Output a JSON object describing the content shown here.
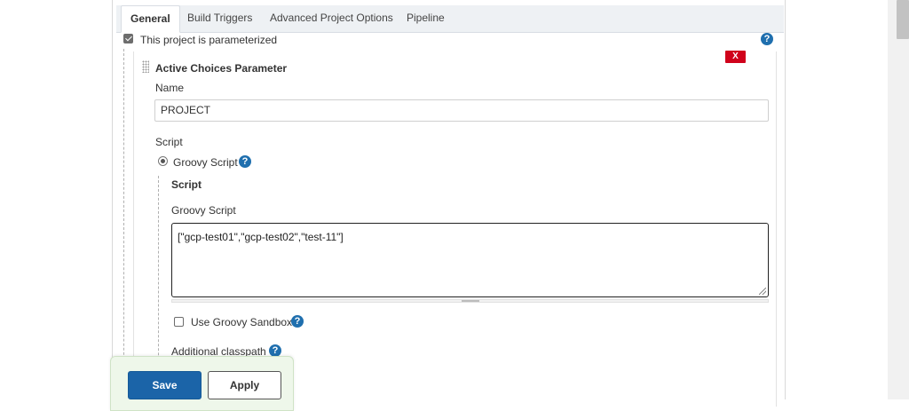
{
  "tabs": [
    {
      "label": "General",
      "active": true
    },
    {
      "label": "Build Triggers",
      "active": false
    },
    {
      "label": "Advanced Project Options",
      "active": false
    },
    {
      "label": "Pipeline",
      "active": false
    }
  ],
  "parameterized": {
    "label": "This project is parameterized",
    "checked": true
  },
  "parameter": {
    "title": "Active Choices Parameter",
    "remove_label": "X",
    "name_label": "Name",
    "name_value": "PROJECT",
    "script_label": "Script",
    "groovy_radio_label": "Groovy Script",
    "script_section_title": "Script",
    "groovy_script_label": "Groovy Script",
    "groovy_script_value": "[\"gcp-test01\",\"gcp-test02\",\"test-11\"]",
    "sandbox_label": "Use Groovy Sandbox",
    "sandbox_checked": false,
    "classpath_label": "Additional classpath"
  },
  "help_glyph": "?",
  "buttons": {
    "save": "Save",
    "apply": "Apply"
  },
  "colors": {
    "primary": "#1b64a8",
    "danger": "#d0021b",
    "help": "#1f6fae"
  }
}
